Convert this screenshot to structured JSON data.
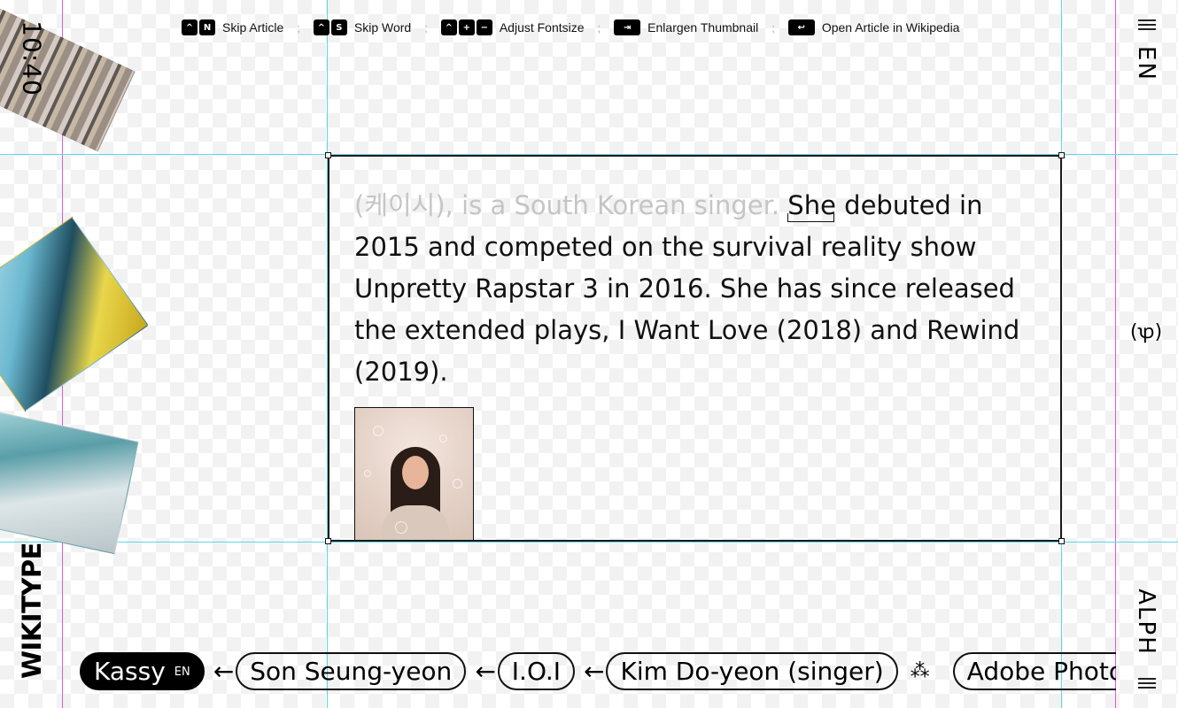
{
  "shortcuts": [
    {
      "keys": [
        "^",
        "N"
      ],
      "label": "Skip Article"
    },
    {
      "keys": [
        "^",
        "S"
      ],
      "label": "Skip Word"
    },
    {
      "keys": [
        "^",
        "+",
        "−"
      ],
      "label": "Adjust Fontsize"
    },
    {
      "keys": [
        "⇥"
      ],
      "label": "Enlargen Thumbnail"
    },
    {
      "keys": [
        "↩"
      ],
      "label": "Open Article in Wikipedia"
    }
  ],
  "separator": ";",
  "clock": "10:40",
  "brand": "WIKITYPE",
  "rail": {
    "language": "EN",
    "glyph": "(ꝕ)",
    "mode": "ALPH"
  },
  "article": {
    "text_read": "(케이시), is a South Korean singer.",
    "current_word": "She",
    "text_rest": "debuted in 2015 and competed on the survival reality show Unpretty Rapstar 3 in 2016. She has since released the extended plays, I Want Love (2018) and Rewind (2019)."
  },
  "trail": {
    "current": {
      "title": "Kassy",
      "lang": "EN"
    },
    "arrow": "←",
    "history": [
      "Son Seung-yeon",
      "I.O.I",
      "Kim Do-yeon (singer)"
    ],
    "cluster_icon": "⁂",
    "next": "Adobe Photoshop"
  },
  "colors": {
    "guide_magenta": "#d85ed8",
    "guide_cyan": "#5ad8e8",
    "faded_text": "#c5c5c5"
  }
}
